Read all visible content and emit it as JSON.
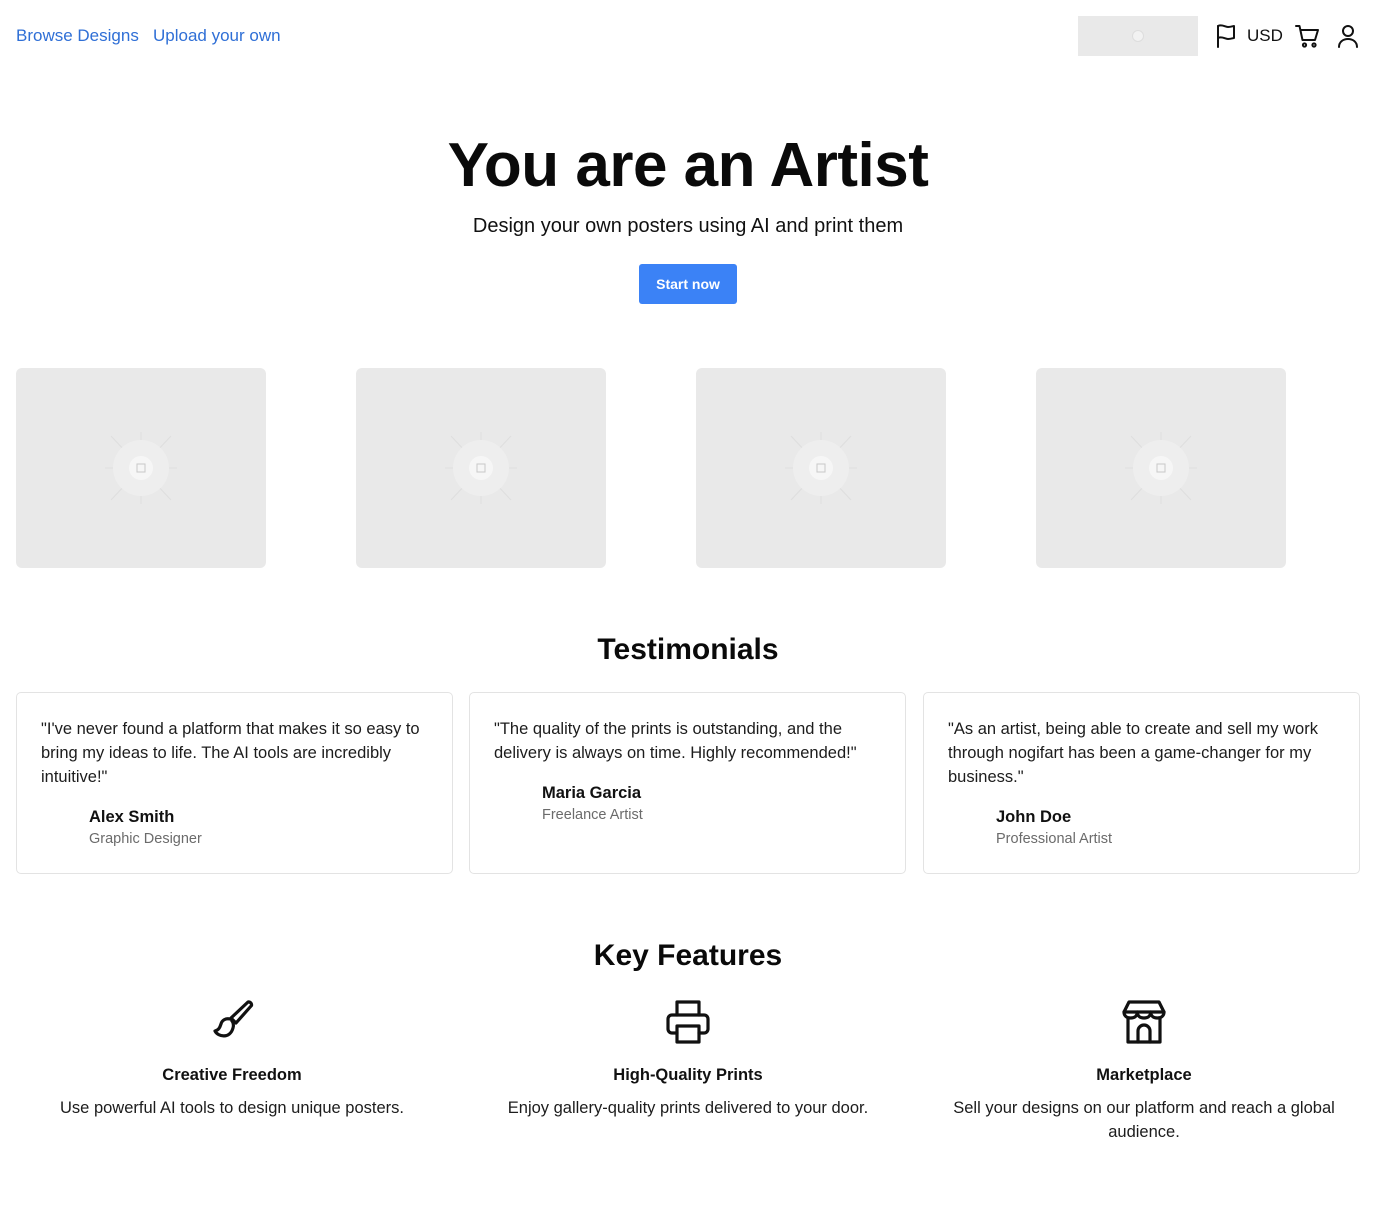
{
  "header": {
    "nav": {
      "browse_label": "Browse Designs",
      "upload_label": "Upload your own"
    },
    "currency": "USD",
    "icons": [
      "flag-icon",
      "cart-icon",
      "user-icon"
    ]
  },
  "hero": {
    "title": "You are an Artist",
    "subtitle": "Design your own posters using AI and print them",
    "cta_label": "Start now"
  },
  "gallery": {
    "count": 4,
    "placeholder_color": "#e9e9e9"
  },
  "testimonials": {
    "title": "Testimonials",
    "items": [
      {
        "quote": "\"I've never found a platform that makes it so easy to bring my ideas to life. The AI tools are incredibly intuitive!\"",
        "name": "Alex Smith",
        "role": "Graphic Designer"
      },
      {
        "quote": "\"The quality of the prints is outstanding, and the delivery is always on time. Highly recommended!\"",
        "name": "Maria Garcia",
        "role": "Freelance Artist"
      },
      {
        "quote": "\"As an artist, being able to create and sell my work through nogifart has been a game-changer for my business.\"",
        "name": "John Doe",
        "role": "Professional Artist"
      }
    ]
  },
  "features": {
    "title": "Key Features",
    "items": [
      {
        "icon": "paintbrush-icon",
        "title": "Creative Freedom",
        "desc": "Use powerful AI tools to design unique posters."
      },
      {
        "icon": "printer-icon",
        "title": "High-Quality Prints",
        "desc": "Enjoy gallery-quality prints delivered to your door."
      },
      {
        "icon": "store-icon",
        "title": "Marketplace",
        "desc": "Sell your designs on our platform and reach a global audience."
      }
    ]
  },
  "colors": {
    "accent": "#3b82f6",
    "link": "#2f6fd6",
    "placeholder": "#e9e9e9"
  }
}
